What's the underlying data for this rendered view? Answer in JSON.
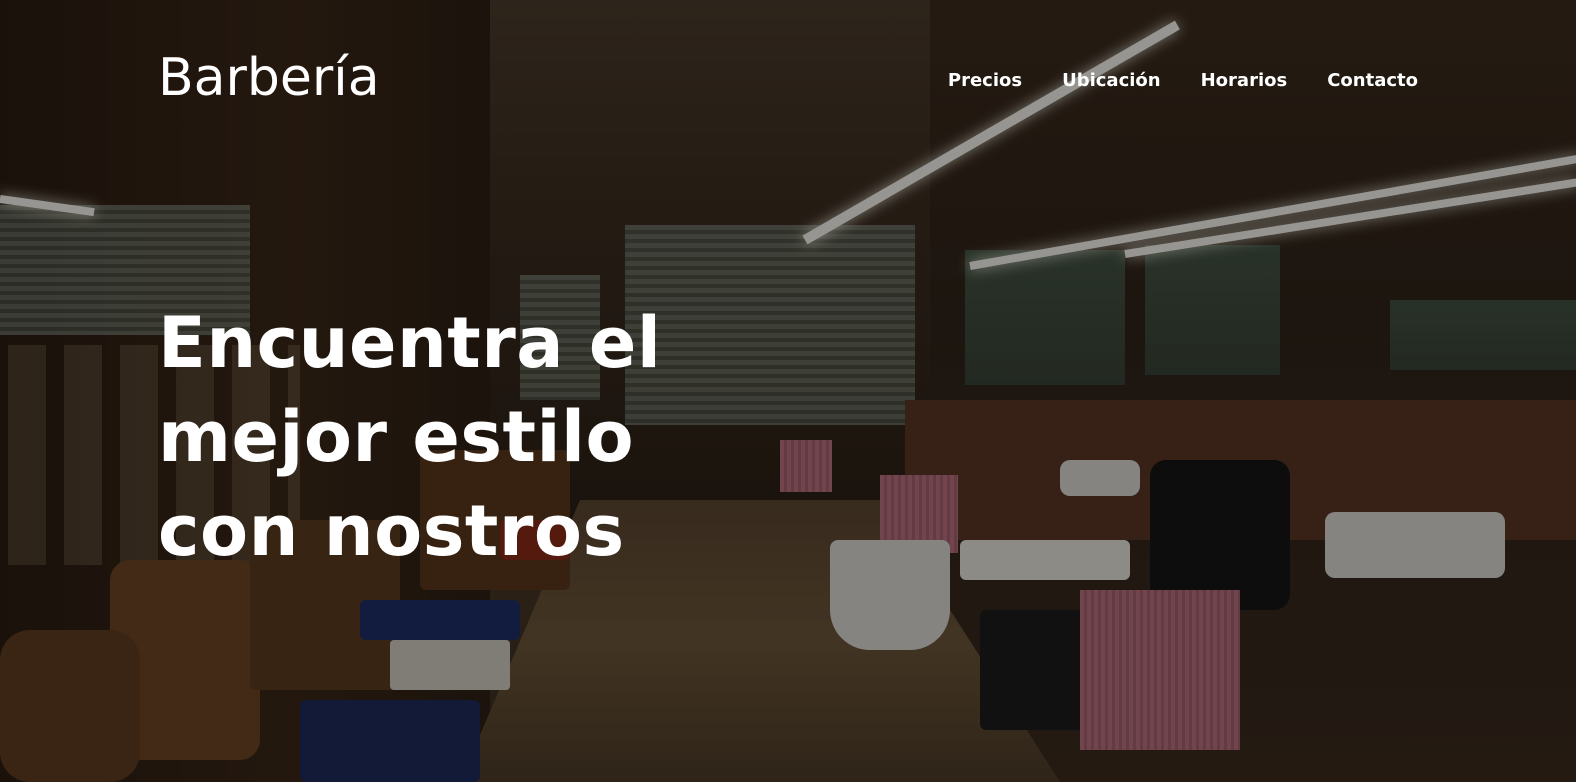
{
  "header": {
    "brand": "Barbería",
    "nav": [
      {
        "label": "Precios"
      },
      {
        "label": "Ubicación"
      },
      {
        "label": "Horarios"
      },
      {
        "label": "Contacto"
      }
    ]
  },
  "hero": {
    "headline": "Encuentra el mejor estilo con nostros",
    "overlay_color": "#000000"
  }
}
